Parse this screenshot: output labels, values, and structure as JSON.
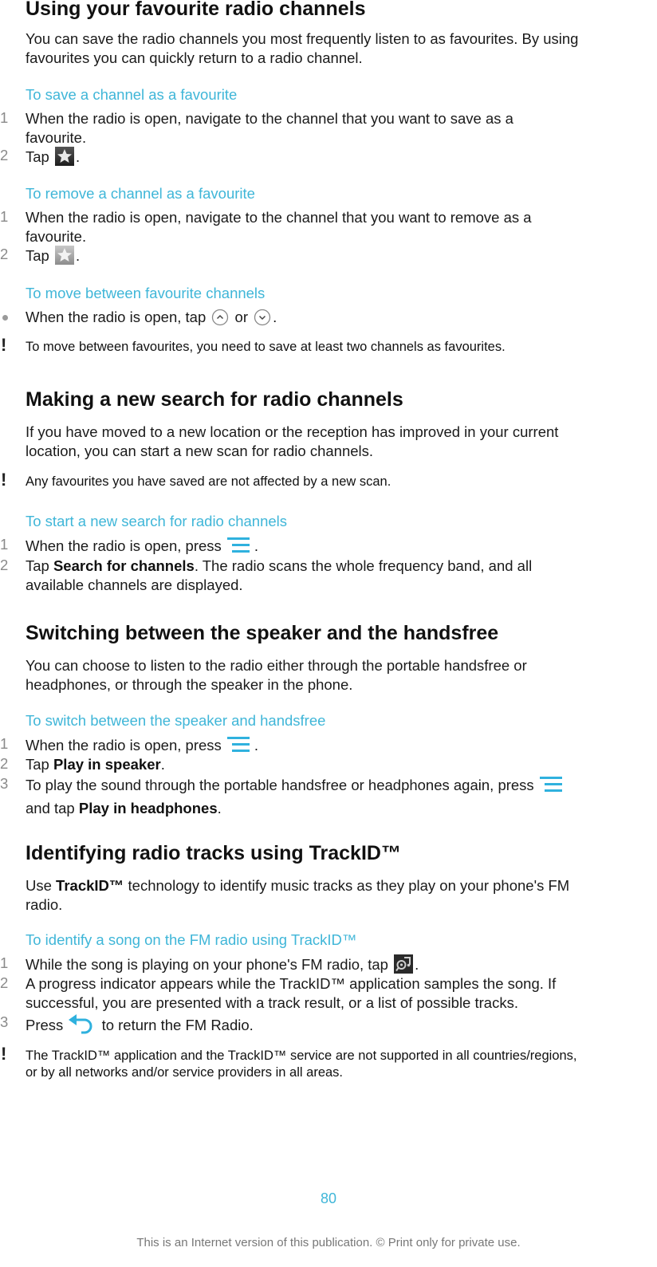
{
  "sections": {
    "favourites": {
      "title": "Using your favourite radio channels",
      "intro_l1": "You can save the radio channels you most frequently listen to as favourites. By using",
      "intro_l2": "favourites you can quickly return to a radio channel.",
      "save": {
        "heading": "To save a channel as a favourite",
        "step1_l1": "When the radio is open, navigate to the channel that you want to save as a",
        "step1_l2": "favourite.",
        "step2_pre": "Tap",
        "step2_post": ".",
        "icon": "star-filled-icon"
      },
      "remove": {
        "heading": "To remove a channel as a favourite",
        "step1_l1": "When the radio is open, navigate to the channel that you want to remove as a",
        "step1_l2": "favourite.",
        "step2_pre": "Tap",
        "step2_post": ".",
        "icon": "star-outline-icon"
      },
      "move": {
        "heading": "To move between favourite channels",
        "bullet_pre": "When the radio is open, tap",
        "bullet_mid": "or",
        "bullet_post": ".",
        "note": "To move between favourites, you need to save at least two channels as favourites."
      }
    },
    "search": {
      "title": "Making a new search for radio channels",
      "intro_l1": "If you have moved to a new location or the reception has improved in your current",
      "intro_l2": "location, you can start a new scan for radio channels.",
      "note": "Any favourites you have saved are not affected by a new scan.",
      "start": {
        "heading": "To start a new search for radio channels",
        "step1_pre": "When the radio is open, press",
        "step1_post": ".",
        "step2_pre": "Tap",
        "step2_bold": "Search for channels",
        "step2_post": ". The radio scans the whole frequency band, and all",
        "step2_l2": "available channels are displayed."
      }
    },
    "speaker": {
      "title": "Switching between the speaker and the handsfree",
      "intro_l1": "You can choose to listen to the radio either through the portable handsfree or",
      "intro_l2": "headphones, or through the speaker in the phone.",
      "switch": {
        "heading": "To switch between the speaker and handsfree",
        "step1_pre": "When the radio is open, press",
        "step1_post": ".",
        "step2_pre": "Tap",
        "step2_bold": "Play in speaker",
        "step2_post": ".",
        "step3_pre": "To play the sound through the portable handsfree or headphones again, press",
        "step3_l2_pre": "and tap",
        "step3_l2_bold": "Play in headphones",
        "step3_l2_post": "."
      }
    },
    "trackid": {
      "title": "Identifying radio tracks using TrackID™",
      "intro_pre": "Use",
      "intro_bold": "TrackID™",
      "intro_post": "technology to identify music tracks as they play on your phone's FM",
      "intro_l2": "radio.",
      "identify": {
        "heading": "To identify a song on the FM radio using TrackID™",
        "step1_pre": "While the song is playing on your phone's FM radio, tap",
        "step1_post": ".",
        "step2_l1": "A progress indicator appears while the TrackID™ application samples the song. If",
        "step2_l2": "successful, you are presented with a track result, or a list of possible tracks.",
        "step3_pre": "Press",
        "step3_post": "to return the FM Radio."
      },
      "note_l1": "The TrackID™ application and the TrackID™ service are not supported in all countries/regions,",
      "note_l2": "or by all networks and/or service providers in all areas."
    }
  },
  "numbers": {
    "n1": "1",
    "n2": "2",
    "n3": "3"
  },
  "page_number": "80",
  "footer": "This is an Internet version of this publication. © Print only for private use.",
  "colors": {
    "accent": "#3fb6d8",
    "numeral": "#8a8a8a",
    "text": "#1a1a1a"
  }
}
